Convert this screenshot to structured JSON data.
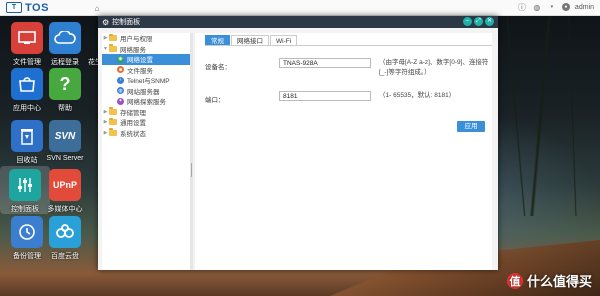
{
  "topbar": {
    "brand": "TOS",
    "brand_badge": "T",
    "user": "admin"
  },
  "desktop": {
    "icons": [
      {
        "label": "文件管理",
        "icon": "monitor-icon",
        "color": "#d8403a"
      },
      {
        "label": "远程登录",
        "icon": "cloud-icon",
        "color": "#2f7fd0"
      },
      {
        "label": "应用中心",
        "icon": "app-store-icon",
        "color": "#1e6fd0"
      },
      {
        "label": "帮助",
        "icon": "help-icon",
        "color": "#46a83e"
      },
      {
        "label": "回收站",
        "icon": "recycle-bin-icon",
        "color": "#2e6fc8"
      },
      {
        "label": "SVN Server",
        "icon": "svn-icon",
        "color": "#3d6e9a"
      },
      {
        "label": "控制面板",
        "icon": "sliders-icon",
        "color": "#1ea5a0"
      },
      {
        "label": "多媒体中心",
        "icon": "upnp-icon",
        "color": "#e24b3a"
      },
      {
        "label": "备份管理",
        "icon": "backup-clock-icon",
        "color": "#3b7ed0"
      },
      {
        "label": "百度云盘",
        "icon": "baidu-cloud-icon",
        "color": "#2aa0d8"
      }
    ],
    "partial_label": "花生"
  },
  "window": {
    "title": "控制面板",
    "sidebar": [
      {
        "label": "用户与权限",
        "level": 0,
        "expanded": false
      },
      {
        "label": "网络服务",
        "level": 0,
        "expanded": true
      },
      {
        "label": "网络设置",
        "level": 1,
        "active": true,
        "icon_color": "#2aa05a"
      },
      {
        "label": "文件服务",
        "level": 1,
        "icon_color": "#e07030"
      },
      {
        "label": "Telnet与SNMP",
        "level": 1,
        "icon_color": "#3a80d0"
      },
      {
        "label": "网站服务器",
        "level": 1,
        "icon_color": "#3a80d0"
      },
      {
        "label": "网络探索服务",
        "level": 1,
        "icon_color": "#9a50c0"
      },
      {
        "label": "存储管理",
        "level": 0,
        "expanded": false
      },
      {
        "label": "通用设置",
        "level": 0,
        "expanded": false
      },
      {
        "label": "系统状态",
        "level": 0,
        "expanded": false
      }
    ],
    "tabs": [
      {
        "label": "常规",
        "active": true
      },
      {
        "label": "网络接口",
        "active": false
      },
      {
        "label": "Wi-Fi",
        "active": false
      }
    ],
    "form": {
      "device_name_label": "设备名：",
      "device_name_value": "TNAS-928A",
      "device_name_hint": "（由字母[A-Z a-z]、数字[0-9]、连接符[_-]等字符组成。）",
      "port_label": "端口：",
      "port_value": "8181",
      "port_hint": "（1- 65535，默认: 8181）",
      "apply_label": "应用"
    }
  },
  "watermark": {
    "badge": "值",
    "text": "什么值得买"
  }
}
